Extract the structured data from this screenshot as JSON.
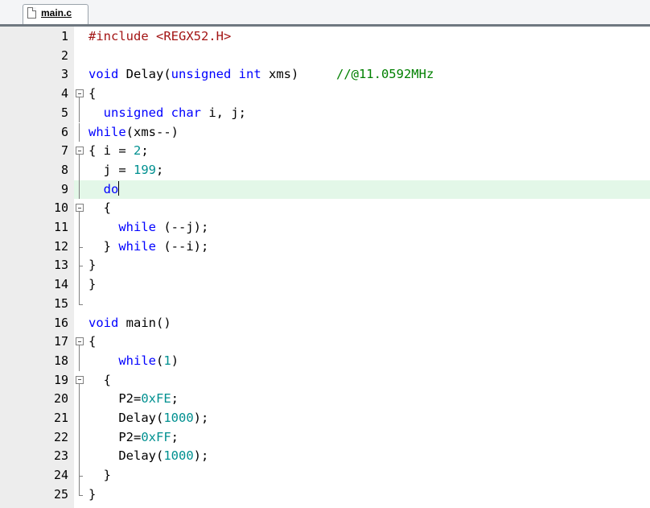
{
  "tab": {
    "label": "main.c",
    "icon": "file-icon"
  },
  "colors": {
    "keyword": "#0000ff",
    "preprocessor": "#a31515",
    "number": "#009090",
    "comment": "#008000",
    "current_line": "#e3f7e8",
    "gutter": "#ededed"
  },
  "editor": {
    "current_line": 9,
    "lines": [
      {
        "n": "1",
        "fold": "none",
        "tokens": [
          {
            "t": "#include <REGX52.H>",
            "c": "pp"
          }
        ]
      },
      {
        "n": "2",
        "fold": "none",
        "tokens": []
      },
      {
        "n": "3",
        "fold": "none",
        "tokens": [
          {
            "t": "void",
            "c": "kw"
          },
          {
            "t": " Delay(",
            "c": "pl"
          },
          {
            "t": "unsigned",
            "c": "kw"
          },
          {
            "t": " ",
            "c": "pl"
          },
          {
            "t": "int",
            "c": "kw"
          },
          {
            "t": " xms)     ",
            "c": "pl"
          },
          {
            "t": "//@11.0592MHz",
            "c": "cm"
          }
        ]
      },
      {
        "n": "4",
        "fold": "open",
        "tokens": [
          {
            "t": "{",
            "c": "pl"
          }
        ]
      },
      {
        "n": "5",
        "fold": "line",
        "tokens": [
          {
            "t": "  ",
            "c": "pl"
          },
          {
            "t": "unsigned",
            "c": "kw"
          },
          {
            "t": " ",
            "c": "pl"
          },
          {
            "t": "char",
            "c": "kw"
          },
          {
            "t": " i, j;",
            "c": "pl"
          }
        ]
      },
      {
        "n": "6",
        "fold": "line",
        "tokens": [
          {
            "t": "while",
            "c": "kw"
          },
          {
            "t": "(xms--)",
            "c": "pl"
          }
        ]
      },
      {
        "n": "7",
        "fold": "open",
        "tokens": [
          {
            "t": "{ i = ",
            "c": "pl"
          },
          {
            "t": "2",
            "c": "num"
          },
          {
            "t": ";",
            "c": "pl"
          }
        ]
      },
      {
        "n": "8",
        "fold": "line",
        "tokens": [
          {
            "t": "  j = ",
            "c": "pl"
          },
          {
            "t": "199",
            "c": "num"
          },
          {
            "t": ";",
            "c": "pl"
          }
        ]
      },
      {
        "n": "9",
        "fold": "line",
        "tokens": [
          {
            "t": "  ",
            "c": "pl"
          },
          {
            "t": "do",
            "c": "kw"
          }
        ],
        "caret": true
      },
      {
        "n": "10",
        "fold": "open",
        "tokens": [
          {
            "t": "  {",
            "c": "pl"
          }
        ]
      },
      {
        "n": "11",
        "fold": "line",
        "tokens": [
          {
            "t": "    ",
            "c": "pl"
          },
          {
            "t": "while",
            "c": "kw"
          },
          {
            "t": " (--j);",
            "c": "pl"
          }
        ]
      },
      {
        "n": "12",
        "fold": "tick",
        "tokens": [
          {
            "t": "  } ",
            "c": "pl"
          },
          {
            "t": "while",
            "c": "kw"
          },
          {
            "t": " (--i);",
            "c": "pl"
          }
        ]
      },
      {
        "n": "13",
        "fold": "tick",
        "tokens": [
          {
            "t": "}",
            "c": "pl"
          }
        ]
      },
      {
        "n": "14",
        "fold": "line",
        "tokens": [
          {
            "t": "}",
            "c": "pl"
          }
        ]
      },
      {
        "n": "15",
        "fold": "end",
        "tokens": []
      },
      {
        "n": "16",
        "fold": "none",
        "tokens": [
          {
            "t": "void",
            "c": "kw"
          },
          {
            "t": " main()",
            "c": "pl"
          }
        ]
      },
      {
        "n": "17",
        "fold": "open",
        "tokens": [
          {
            "t": "{",
            "c": "pl"
          }
        ]
      },
      {
        "n": "18",
        "fold": "line",
        "tokens": [
          {
            "t": "    ",
            "c": "pl"
          },
          {
            "t": "while",
            "c": "kw"
          },
          {
            "t": "(",
            "c": "pl"
          },
          {
            "t": "1",
            "c": "num"
          },
          {
            "t": ")",
            "c": "pl"
          }
        ]
      },
      {
        "n": "19",
        "fold": "open",
        "tokens": [
          {
            "t": "  {",
            "c": "pl"
          }
        ]
      },
      {
        "n": "20",
        "fold": "line",
        "tokens": [
          {
            "t": "    P2=",
            "c": "pl"
          },
          {
            "t": "0xFE",
            "c": "num"
          },
          {
            "t": ";",
            "c": "pl"
          }
        ]
      },
      {
        "n": "21",
        "fold": "line",
        "tokens": [
          {
            "t": "    Delay(",
            "c": "pl"
          },
          {
            "t": "1000",
            "c": "num"
          },
          {
            "t": ");",
            "c": "pl"
          }
        ]
      },
      {
        "n": "22",
        "fold": "line",
        "tokens": [
          {
            "t": "    P2=",
            "c": "pl"
          },
          {
            "t": "0xFF",
            "c": "num"
          },
          {
            "t": ";",
            "c": "pl"
          }
        ]
      },
      {
        "n": "23",
        "fold": "line",
        "tokens": [
          {
            "t": "    Delay(",
            "c": "pl"
          },
          {
            "t": "1000",
            "c": "num"
          },
          {
            "t": ");",
            "c": "pl"
          }
        ]
      },
      {
        "n": "24",
        "fold": "tick",
        "tokens": [
          {
            "t": "  }",
            "c": "pl"
          }
        ]
      },
      {
        "n": "25",
        "fold": "end",
        "tokens": [
          {
            "t": "}",
            "c": "pl"
          }
        ]
      }
    ]
  }
}
